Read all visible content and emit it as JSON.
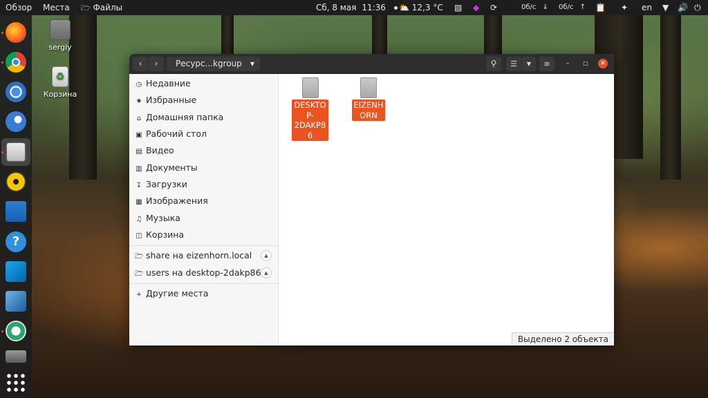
{
  "topbar": {
    "activities": "Обзор",
    "places": "Места",
    "app_name": "Файлы",
    "date": "Сб, 8 мая",
    "time": "11:36",
    "temperature": "12,3 °C",
    "net_down": "0б/с",
    "net_up": "0б/с",
    "language": "en"
  },
  "desktop": {
    "home_label": "sergiy",
    "trash_label": "Корзина"
  },
  "window": {
    "path_label": "Ресурс...kgroup",
    "sidebar": {
      "items": [
        {
          "label": "Недавние",
          "icon": "clock-icon"
        },
        {
          "label": "Избранные",
          "icon": "star-icon"
        },
        {
          "label": "Домашняя папка",
          "icon": "home-icon"
        },
        {
          "label": "Рабочий стол",
          "icon": "desktop-icon"
        },
        {
          "label": "Видео",
          "icon": "video-icon"
        },
        {
          "label": "Документы",
          "icon": "document-icon"
        },
        {
          "label": "Загрузки",
          "icon": "download-icon"
        },
        {
          "label": "Изображения",
          "icon": "image-icon"
        },
        {
          "label": "Музыка",
          "icon": "music-icon"
        },
        {
          "label": "Корзина",
          "icon": "trash-icon"
        }
      ],
      "network": [
        {
          "label": "share на eizenhorn.local"
        },
        {
          "label": "users на desktop-2dakp86"
        }
      ],
      "other_places": "Другие места"
    },
    "files": [
      {
        "name_lines": [
          "DESKTO",
          "P-",
          "2DAKP8",
          "6"
        ]
      },
      {
        "name_lines": [
          "EIZENH",
          "ORN"
        ]
      }
    ],
    "status": "Выделено 2 объекта"
  },
  "colors": {
    "accent": "#e95420",
    "topbar": "#1d1d1d",
    "headerbar": "#2d2d2d"
  }
}
